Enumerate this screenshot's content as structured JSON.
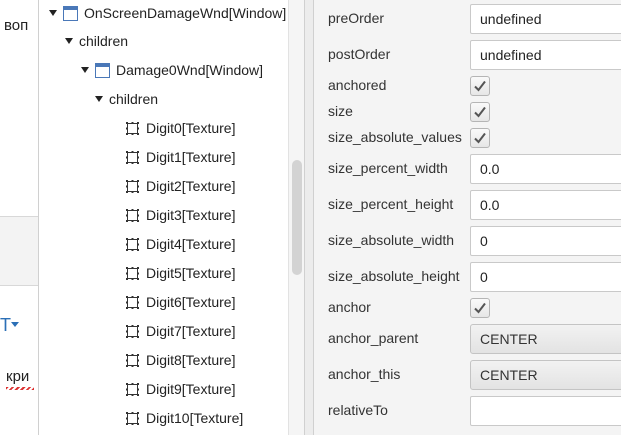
{
  "background_window": {
    "text_top": "воп",
    "text_bottom": "кри"
  },
  "tree": {
    "items": [
      {
        "label": "OnScreenDamageWnd[Window]",
        "type": "window",
        "expanded": true
      },
      {
        "label": "children",
        "type": "group",
        "expanded": true
      },
      {
        "label": "Damage0Wnd[Window]",
        "type": "window",
        "expanded": true
      },
      {
        "label": "children",
        "type": "group",
        "expanded": true
      },
      {
        "label": "Digit0[Texture]",
        "type": "texture"
      },
      {
        "label": "Digit1[Texture]",
        "type": "texture"
      },
      {
        "label": "Digit2[Texture]",
        "type": "texture"
      },
      {
        "label": "Digit3[Texture]",
        "type": "texture"
      },
      {
        "label": "Digit4[Texture]",
        "type": "texture"
      },
      {
        "label": "Digit5[Texture]",
        "type": "texture"
      },
      {
        "label": "Digit6[Texture]",
        "type": "texture"
      },
      {
        "label": "Digit7[Texture]",
        "type": "texture"
      },
      {
        "label": "Digit8[Texture]",
        "type": "texture"
      },
      {
        "label": "Digit9[Texture]",
        "type": "texture"
      },
      {
        "label": "Digit10[Texture]",
        "type": "texture"
      }
    ]
  },
  "properties": [
    {
      "label": "preOrder",
      "kind": "text",
      "value": "undefined"
    },
    {
      "label": "postOrder",
      "kind": "text",
      "value": "undefined"
    },
    {
      "label": "anchored",
      "kind": "checkbox",
      "checked": true
    },
    {
      "label": "size",
      "kind": "checkbox",
      "checked": true
    },
    {
      "label": "size_absolute_values",
      "kind": "checkbox",
      "checked": true
    },
    {
      "label": "size_percent_width",
      "kind": "text",
      "value": "0.0"
    },
    {
      "label": "size_percent_height",
      "kind": "text",
      "value": "0.0"
    },
    {
      "label": "size_absolute_width",
      "kind": "text",
      "value": "0"
    },
    {
      "label": "size_absolute_height",
      "kind": "text",
      "value": "0"
    },
    {
      "label": "anchor",
      "kind": "checkbox",
      "checked": true
    },
    {
      "label": "anchor_parent",
      "kind": "select",
      "value": "CENTER"
    },
    {
      "label": "anchor_this",
      "kind": "select",
      "value": "CENTER"
    },
    {
      "label": "relativeTo",
      "kind": "text",
      "value": ""
    }
  ],
  "colors": {
    "window_icon": "#4a78b8",
    "panel_bg": "#f4f4f4",
    "check_mark": "#555555"
  }
}
